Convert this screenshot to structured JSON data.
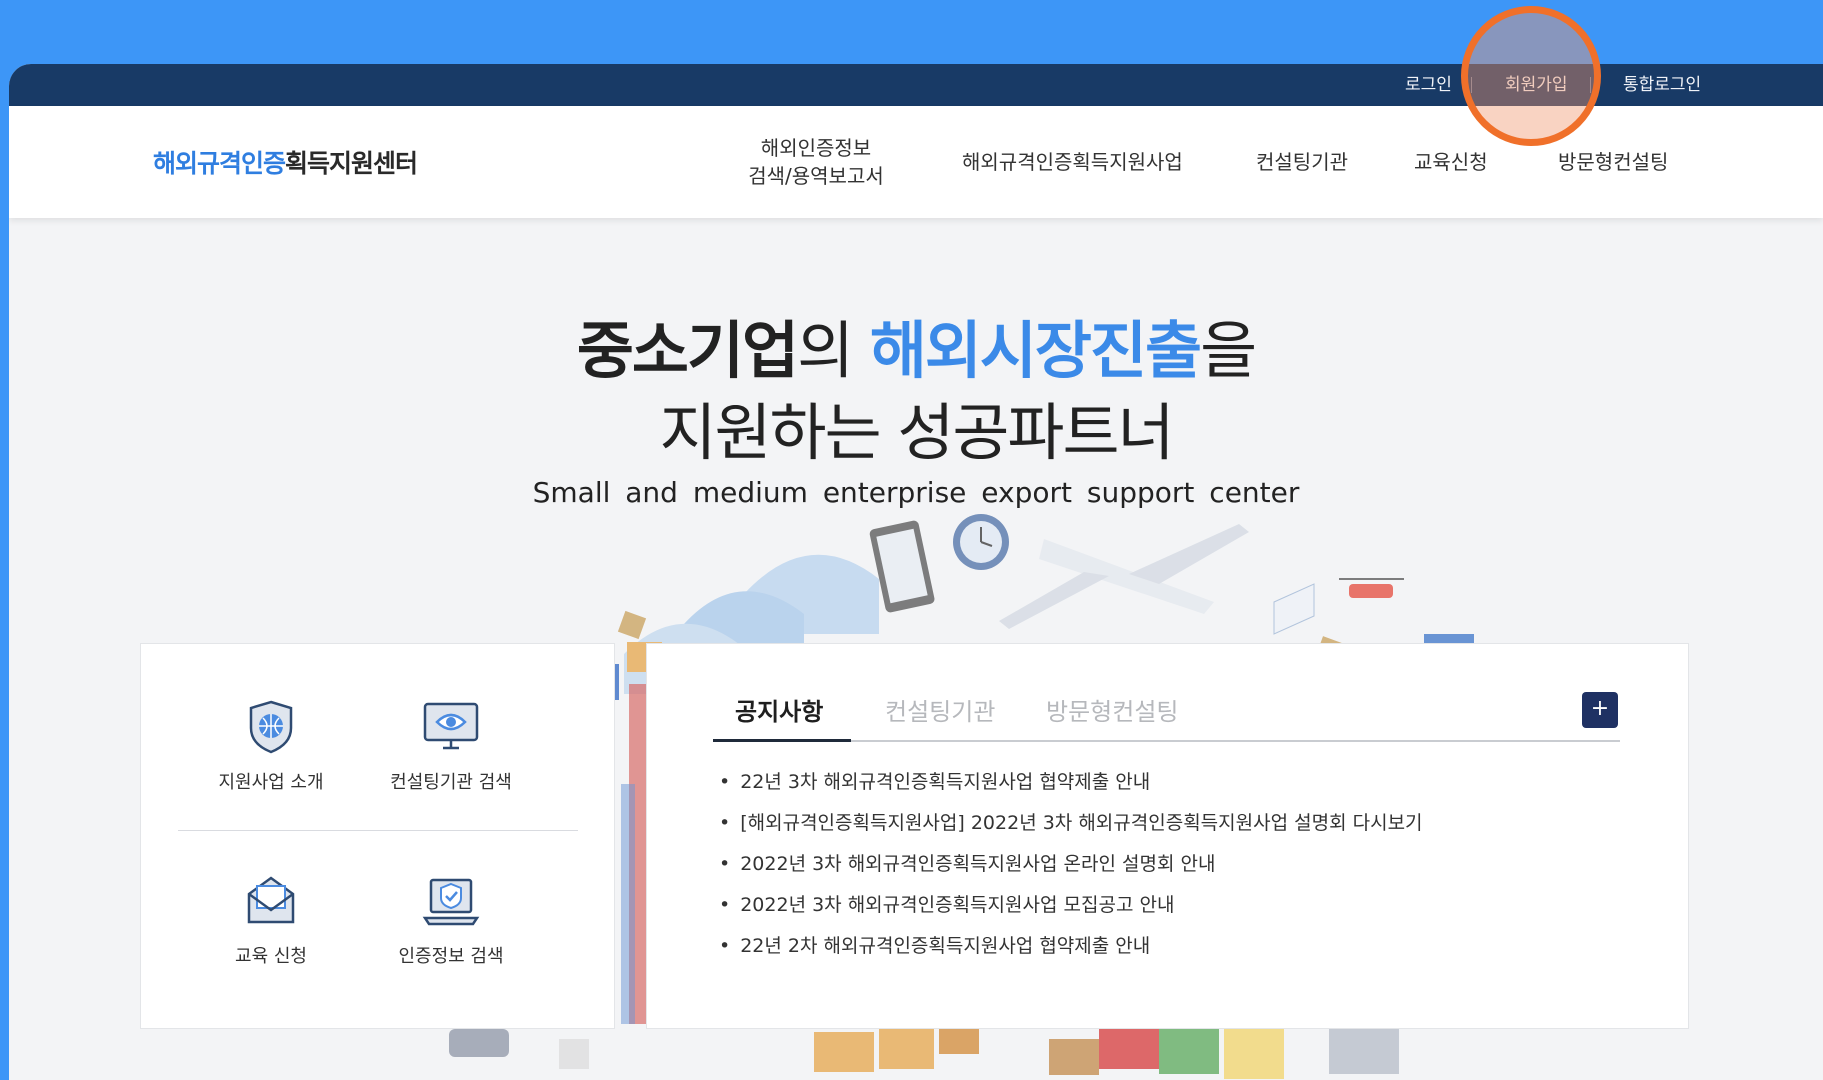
{
  "top_bar": {
    "login": "로그인",
    "signup": "회원가입",
    "unified_login": "통합로그인"
  },
  "header": {
    "logo_part1": "해외규격인증",
    "logo_part2": "획득지원센터",
    "nav": [
      {
        "line1": "해외인증정보",
        "line2": "검색/용역보고서"
      },
      {
        "line1": "해외규격인증획득지원사업"
      },
      {
        "line1": "컨설팅기관"
      },
      {
        "line1": "교육신청"
      },
      {
        "line1": "방문형컨설팅"
      }
    ]
  },
  "hero": {
    "line1_a": "중소기업",
    "line1_b": "의 ",
    "line1_c": "해외시장진출",
    "line1_d": "을",
    "line2_a": "지원하는 ",
    "line2_b": "성공파트너",
    "subtitle": "Small and medium enterprise export support center"
  },
  "quick_menu": [
    {
      "label": "지원사업 소개",
      "icon": "shield-globe-icon"
    },
    {
      "label": "컨설팅기관 검색",
      "icon": "monitor-eye-icon"
    },
    {
      "label": "교육 신청",
      "icon": "envelope-icon"
    },
    {
      "label": "인증정보 검색",
      "icon": "laptop-check-icon"
    }
  ],
  "notice": {
    "tabs": [
      "공지사항",
      "컨설팅기관",
      "방문형컨설팅"
    ],
    "active_tab": "공지사항",
    "more_label": "+",
    "items": [
      "22년 3차 해외규격인증획득지원사업 협약제출 안내",
      "[해외규격인증획득지원사업] 2022년 3차 해외규격인증획득지원사업 설명회 다시보기",
      "2022년 3차 해외규격인증획득지원사업 온라인 설명회 안내",
      "2022년 3차 해외규격인증획득지원사업 모집공고 안내",
      "22년 2차 해외규격인증획득지원사업 협약제출 안내"
    ]
  },
  "colors": {
    "background": "#3d96f7",
    "top_bar": "#183a66",
    "accent_blue": "#3b8ae8",
    "highlight": "#f0702a",
    "more_button": "#1f3163"
  }
}
